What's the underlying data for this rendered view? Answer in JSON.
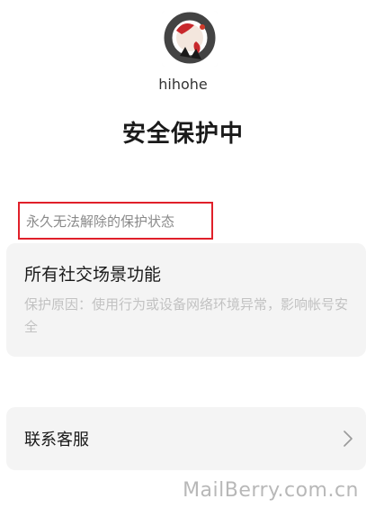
{
  "profile": {
    "avatar_icon": "ink-art-avatar-icon",
    "username": "hihohe"
  },
  "page": {
    "title": "安全保护中"
  },
  "protection": {
    "note": "永久无法解除的保护状态",
    "highlight_color": "#e0202a",
    "feature": {
      "title": "所有社交场景功能",
      "reason": "保护原因：使用行为或设备网络环境异常，影响帐号安全"
    }
  },
  "support": {
    "label": "联系客服",
    "arrow_icon": "chevron-right-icon"
  },
  "watermark": {
    "text": "MailBerry.com.cn"
  }
}
